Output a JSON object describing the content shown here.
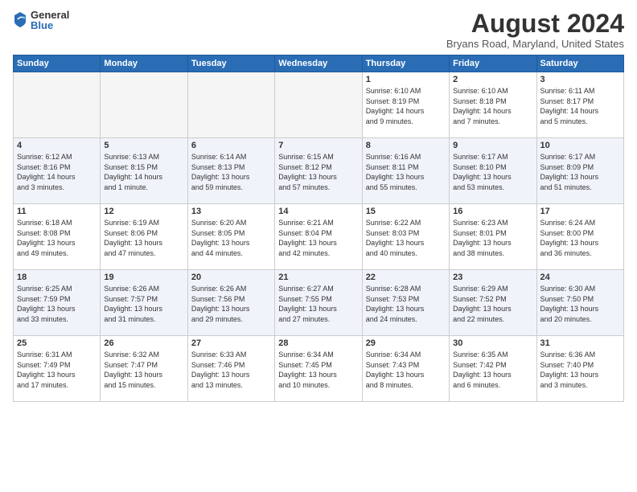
{
  "header": {
    "logo_general": "General",
    "logo_blue": "Blue",
    "month_title": "August 2024",
    "subtitle": "Bryans Road, Maryland, United States"
  },
  "weekdays": [
    "Sunday",
    "Monday",
    "Tuesday",
    "Wednesday",
    "Thursday",
    "Friday",
    "Saturday"
  ],
  "weeks": [
    [
      {
        "day": "",
        "info": ""
      },
      {
        "day": "",
        "info": ""
      },
      {
        "day": "",
        "info": ""
      },
      {
        "day": "",
        "info": ""
      },
      {
        "day": "1",
        "info": "Sunrise: 6:10 AM\nSunset: 8:19 PM\nDaylight: 14 hours\nand 9 minutes."
      },
      {
        "day": "2",
        "info": "Sunrise: 6:10 AM\nSunset: 8:18 PM\nDaylight: 14 hours\nand 7 minutes."
      },
      {
        "day": "3",
        "info": "Sunrise: 6:11 AM\nSunset: 8:17 PM\nDaylight: 14 hours\nand 5 minutes."
      }
    ],
    [
      {
        "day": "4",
        "info": "Sunrise: 6:12 AM\nSunset: 8:16 PM\nDaylight: 14 hours\nand 3 minutes."
      },
      {
        "day": "5",
        "info": "Sunrise: 6:13 AM\nSunset: 8:15 PM\nDaylight: 14 hours\nand 1 minute."
      },
      {
        "day": "6",
        "info": "Sunrise: 6:14 AM\nSunset: 8:13 PM\nDaylight: 13 hours\nand 59 minutes."
      },
      {
        "day": "7",
        "info": "Sunrise: 6:15 AM\nSunset: 8:12 PM\nDaylight: 13 hours\nand 57 minutes."
      },
      {
        "day": "8",
        "info": "Sunrise: 6:16 AM\nSunset: 8:11 PM\nDaylight: 13 hours\nand 55 minutes."
      },
      {
        "day": "9",
        "info": "Sunrise: 6:17 AM\nSunset: 8:10 PM\nDaylight: 13 hours\nand 53 minutes."
      },
      {
        "day": "10",
        "info": "Sunrise: 6:17 AM\nSunset: 8:09 PM\nDaylight: 13 hours\nand 51 minutes."
      }
    ],
    [
      {
        "day": "11",
        "info": "Sunrise: 6:18 AM\nSunset: 8:08 PM\nDaylight: 13 hours\nand 49 minutes."
      },
      {
        "day": "12",
        "info": "Sunrise: 6:19 AM\nSunset: 8:06 PM\nDaylight: 13 hours\nand 47 minutes."
      },
      {
        "day": "13",
        "info": "Sunrise: 6:20 AM\nSunset: 8:05 PM\nDaylight: 13 hours\nand 44 minutes."
      },
      {
        "day": "14",
        "info": "Sunrise: 6:21 AM\nSunset: 8:04 PM\nDaylight: 13 hours\nand 42 minutes."
      },
      {
        "day": "15",
        "info": "Sunrise: 6:22 AM\nSunset: 8:03 PM\nDaylight: 13 hours\nand 40 minutes."
      },
      {
        "day": "16",
        "info": "Sunrise: 6:23 AM\nSunset: 8:01 PM\nDaylight: 13 hours\nand 38 minutes."
      },
      {
        "day": "17",
        "info": "Sunrise: 6:24 AM\nSunset: 8:00 PM\nDaylight: 13 hours\nand 36 minutes."
      }
    ],
    [
      {
        "day": "18",
        "info": "Sunrise: 6:25 AM\nSunset: 7:59 PM\nDaylight: 13 hours\nand 33 minutes."
      },
      {
        "day": "19",
        "info": "Sunrise: 6:26 AM\nSunset: 7:57 PM\nDaylight: 13 hours\nand 31 minutes."
      },
      {
        "day": "20",
        "info": "Sunrise: 6:26 AM\nSunset: 7:56 PM\nDaylight: 13 hours\nand 29 minutes."
      },
      {
        "day": "21",
        "info": "Sunrise: 6:27 AM\nSunset: 7:55 PM\nDaylight: 13 hours\nand 27 minutes."
      },
      {
        "day": "22",
        "info": "Sunrise: 6:28 AM\nSunset: 7:53 PM\nDaylight: 13 hours\nand 24 minutes."
      },
      {
        "day": "23",
        "info": "Sunrise: 6:29 AM\nSunset: 7:52 PM\nDaylight: 13 hours\nand 22 minutes."
      },
      {
        "day": "24",
        "info": "Sunrise: 6:30 AM\nSunset: 7:50 PM\nDaylight: 13 hours\nand 20 minutes."
      }
    ],
    [
      {
        "day": "25",
        "info": "Sunrise: 6:31 AM\nSunset: 7:49 PM\nDaylight: 13 hours\nand 17 minutes."
      },
      {
        "day": "26",
        "info": "Sunrise: 6:32 AM\nSunset: 7:47 PM\nDaylight: 13 hours\nand 15 minutes."
      },
      {
        "day": "27",
        "info": "Sunrise: 6:33 AM\nSunset: 7:46 PM\nDaylight: 13 hours\nand 13 minutes."
      },
      {
        "day": "28",
        "info": "Sunrise: 6:34 AM\nSunset: 7:45 PM\nDaylight: 13 hours\nand 10 minutes."
      },
      {
        "day": "29",
        "info": "Sunrise: 6:34 AM\nSunset: 7:43 PM\nDaylight: 13 hours\nand 8 minutes."
      },
      {
        "day": "30",
        "info": "Sunrise: 6:35 AM\nSunset: 7:42 PM\nDaylight: 13 hours\nand 6 minutes."
      },
      {
        "day": "31",
        "info": "Sunrise: 6:36 AM\nSunset: 7:40 PM\nDaylight: 13 hours\nand 3 minutes."
      }
    ]
  ]
}
